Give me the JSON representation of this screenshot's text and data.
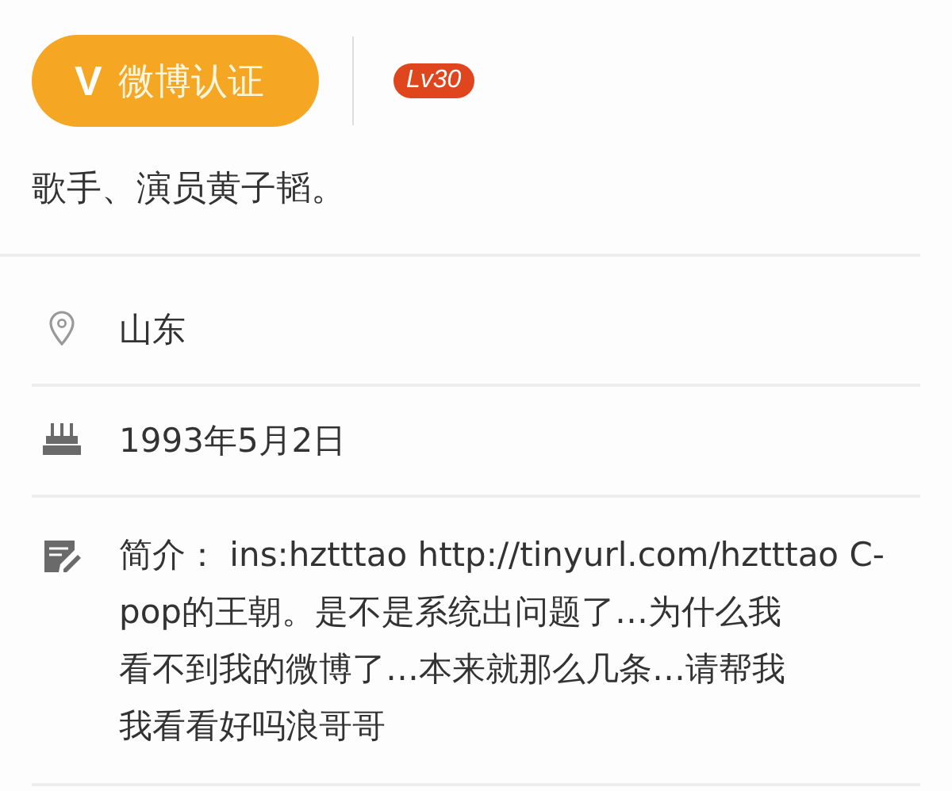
{
  "verified_badge": {
    "mark": "V",
    "label": "微博认证"
  },
  "level_badge": "Lv30",
  "bio": "歌手、演员黄子韬。",
  "details": [
    {
      "kind": "location",
      "lines": [
        "山东"
      ]
    },
    {
      "kind": "birthday",
      "lines": [
        "1993年5月2日"
      ]
    },
    {
      "kind": "intro",
      "lines": [
        "**简介：** ins:hztttao http://tinyurl.com/hztttao C-",
        "pop的王朝。是不是系统出问题了…为什么我",
        "看不到我的微博了…本来就那么几条…请帮我",
        "我看看好吗浪哥哥"
      ]
    }
  ]
}
